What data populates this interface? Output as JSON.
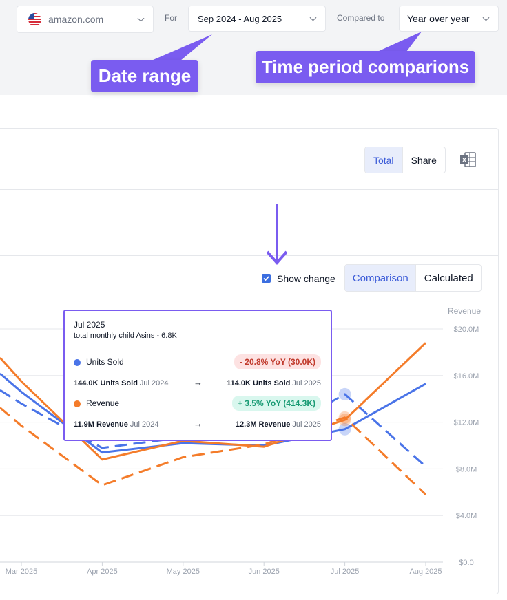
{
  "header": {
    "domain": {
      "value": "amazon.com",
      "flag": "us-flag-icon"
    },
    "for_label": "For",
    "date_range": "Sep 2024 - Aug 2025",
    "compared_label": "Compared to",
    "compare_value": "Year over year"
  },
  "callouts": {
    "date": "Date range",
    "time": "Time period comparions"
  },
  "toolbar": {
    "total_label": "Total",
    "share_label": "Share",
    "export_icon": "excel-icon",
    "show_change_label": "Show change",
    "show_change_checked": true,
    "comparison_label": "Comparison",
    "calculated_label": "Calculated"
  },
  "tooltip": {
    "title": "Jul 2025",
    "subtitle": "total monthly child Asins - 6.8K",
    "units": {
      "label": "Units Sold",
      "change": "- 20.8% YoY (30.0K)",
      "prev_value": "144.0K Units Sold",
      "prev_period": "Jul 2024",
      "curr_value": "114.0K Units Sold",
      "curr_period": "Jul 2025"
    },
    "revenue": {
      "label": "Revenue",
      "change": "+ 3.5% YoY (414.3K)",
      "prev_value": "11.9M Revenue",
      "prev_period": "Jul 2024",
      "curr_value": "12.3M Revenue",
      "curr_period": "Jul 2025"
    }
  },
  "colors": {
    "units": "#4a74e8",
    "revenue": "#f47c2a",
    "accent": "#7a5cf0"
  },
  "chart_data": {
    "type": "line",
    "x": [
      "Mar 2025",
      "Apr 2025",
      "May 2025",
      "Jun 2025",
      "Jul 2025",
      "Aug 2025"
    ],
    "y_right_label": "Revenue",
    "y_right_ticks": [
      "$0.0",
      "$4.0M",
      "$8.0M",
      "$12.0M",
      "$16.0M",
      "$20.0M"
    ],
    "ylim": [
      0,
      20
    ],
    "series": [
      {
        "key": "units_current",
        "color": "#4a74e8",
        "dashed": false,
        "values": [
          14.6,
          9.4,
          10.2,
          10.0,
          11.4,
          15.3
        ]
      },
      {
        "key": "units_previous",
        "color": "#4a74e8",
        "dashed": true,
        "values": [
          13.6,
          9.8,
          10.7,
          10.5,
          14.4,
          8.2
        ]
      },
      {
        "key": "revenue_current",
        "color": "#f47c2a",
        "dashed": false,
        "values": [
          15.5,
          8.8,
          10.4,
          9.9,
          12.2,
          18.8
        ]
      },
      {
        "key": "revenue_previous",
        "color": "#f47c2a",
        "dashed": true,
        "values": [
          11.7,
          6.6,
          9.0,
          10.1,
          12.4,
          5.8
        ]
      }
    ]
  }
}
